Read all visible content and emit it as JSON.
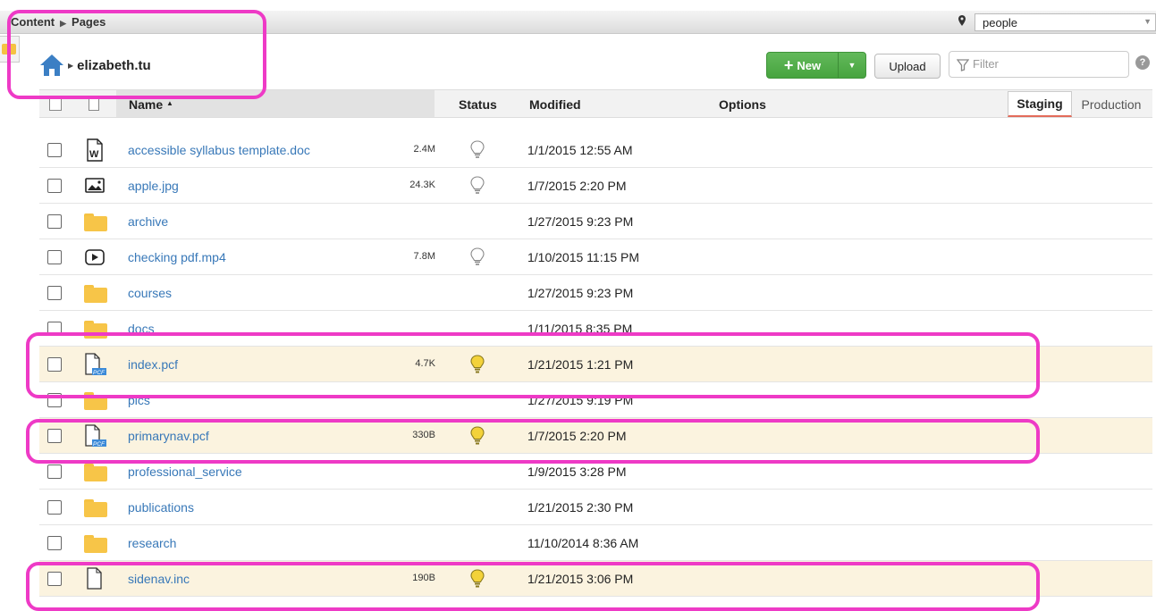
{
  "breadcrumb": [
    "Content",
    "Pages"
  ],
  "site_selector": {
    "value": "people"
  },
  "location": {
    "folder": "elizabeth.tu"
  },
  "toolbar": {
    "new_label": "New",
    "upload_label": "Upload",
    "filter_placeholder": "Filter",
    "help": "?"
  },
  "columns": {
    "name": "Name",
    "status": "Status",
    "modified": "Modified",
    "options": "Options"
  },
  "environments": {
    "staging": "Staging",
    "production": "Production"
  },
  "colors": {
    "link": "#3878b8",
    "new_button": "#4fad47",
    "highlight_row": "#fbf3df",
    "annotation": "#ee3ac6"
  },
  "files": [
    {
      "name": "accessible syllabus template.doc",
      "type": "word-icon",
      "size": "2.4M",
      "status": "unpublished",
      "modified": "1/1/2015 12:55 AM",
      "highlight": false
    },
    {
      "name": "apple.jpg",
      "type": "image-icon",
      "size": "24.3K",
      "status": "unpublished",
      "modified": "1/7/2015 2:20 PM",
      "highlight": false
    },
    {
      "name": "archive",
      "type": "folder-icon",
      "size": "",
      "status": "",
      "modified": "1/27/2015 9:23 PM",
      "highlight": false
    },
    {
      "name": "checking pdf.mp4",
      "type": "video-icon",
      "size": "7.8M",
      "status": "unpublished",
      "modified": "1/10/2015 11:15 PM",
      "highlight": false
    },
    {
      "name": "courses",
      "type": "folder-icon",
      "size": "",
      "status": "",
      "modified": "1/27/2015 9:23 PM",
      "highlight": false
    },
    {
      "name": "docs",
      "type": "folder-icon",
      "size": "",
      "status": "",
      "modified": "1/11/2015 8:35 PM",
      "highlight": false
    },
    {
      "name": "index.pcf",
      "type": "pcf-icon",
      "size": "4.7K",
      "status": "published",
      "modified": "1/21/2015 1:21 PM",
      "highlight": true
    },
    {
      "name": "pics",
      "type": "folder-icon",
      "size": "",
      "status": "",
      "modified": "1/27/2015 9:19 PM",
      "highlight": false
    },
    {
      "name": "primarynav.pcf",
      "type": "pcf-icon",
      "size": "330B",
      "status": "published",
      "modified": "1/7/2015 2:20 PM",
      "highlight": true
    },
    {
      "name": "professional_service",
      "type": "folder-icon",
      "size": "",
      "status": "",
      "modified": "1/9/2015 3:28 PM",
      "highlight": false
    },
    {
      "name": "publications",
      "type": "folder-icon",
      "size": "",
      "status": "",
      "modified": "1/21/2015 2:30 PM",
      "highlight": false
    },
    {
      "name": "research",
      "type": "folder-icon",
      "size": "",
      "status": "",
      "modified": "11/10/2014 8:36 AM",
      "highlight": false
    },
    {
      "name": "sidenav.inc",
      "type": "file-icon",
      "size": "190B",
      "status": "published",
      "modified": "1/21/2015 3:06 PM",
      "highlight": true
    }
  ]
}
